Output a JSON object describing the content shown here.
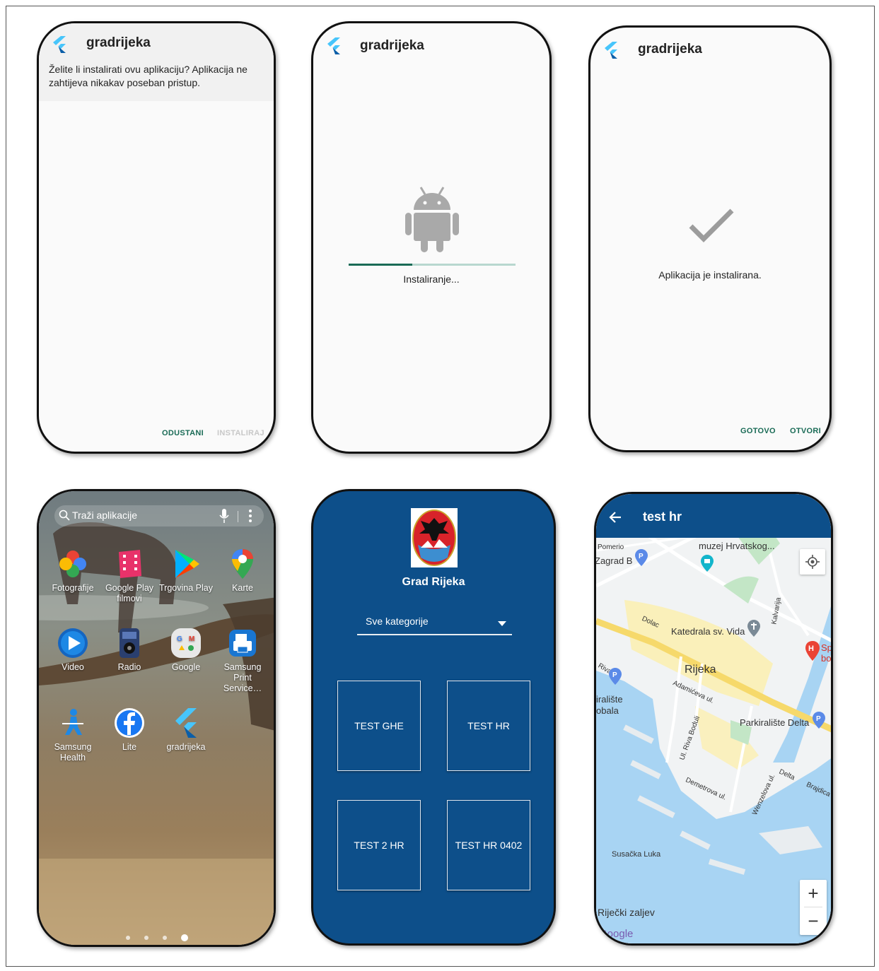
{
  "screen1": {
    "title": "gradrijeka",
    "prompt": "Želite li instalirati ovu aplikaciju? Aplikacija ne zahtijeva nikakav poseban pristup.",
    "cancel_label": "ODUSTANI",
    "install_label": "INSTALIRAJ"
  },
  "screen2": {
    "title": "gradrijeka",
    "status": "Instaliranje...",
    "progress": 0.38
  },
  "screen3": {
    "title": "gradrijeka",
    "status": "Aplikacija je instalirana.",
    "done_label": "GOTOVO",
    "open_label": "OTVORI"
  },
  "screen4": {
    "search_placeholder": "Traži aplikacije",
    "apps": [
      {
        "label": "Fotografije",
        "icon": "google-photos-icon"
      },
      {
        "label": "Google Play filmovi",
        "icon": "play-movies-icon"
      },
      {
        "label": "Trgovina Play",
        "icon": "play-store-icon"
      },
      {
        "label": "Karte",
        "icon": "maps-icon"
      },
      {
        "label": "Video",
        "icon": "video-icon"
      },
      {
        "label": "Radio",
        "icon": "radio-icon"
      },
      {
        "label": "Google",
        "icon": "google-folder-icon"
      },
      {
        "label": "Samsung Print Service…",
        "icon": "print-service-icon"
      },
      {
        "label": "Samsung Health",
        "icon": "samsung-health-icon"
      },
      {
        "label": "Lite",
        "icon": "facebook-lite-icon"
      },
      {
        "label": "gradrijeka",
        "icon": "flutter-icon"
      }
    ],
    "page_dots": 4,
    "active_page": 4
  },
  "screen5": {
    "title": "Grad Rijeka",
    "dropdown_value": "Sve kategorije",
    "tiles": [
      "TEST GHE",
      "TEST HR",
      "TEST 2 HR",
      "TEST HR 0402"
    ],
    "bg_color": "#0d4f8a"
  },
  "screen6": {
    "title": "test hr",
    "labels": {
      "muzej": "muzej Hrvatskog...",
      "pomerio": "Pomerio",
      "zagrad": "Zagrad B",
      "katedrala": "Katedrala sv. Vida",
      "rijeka": "Rijeka",
      "parkiraliste_obala": "iralište\nobala",
      "parkiraliste_delta": "Parkiralište Delta",
      "adamiceva": "Adamićeva ul.",
      "riva_boduli": "Ul. Riva Boduli",
      "demetrova": "Demetrova ul.",
      "wenzelova": "Wenzelova ul.",
      "delta": "Delta",
      "brajdica": "Brajdica",
      "susacka_luka": "Susačka Luka",
      "rijecki_zaljev": "Riječki zaljev",
      "dolac": "Dolac",
      "kalvarija": "Kalvarija",
      "riva": "Riva",
      "hospital": "Sp\nbol",
      "google": "Google"
    },
    "zoom_in": "+",
    "zoom_out": "−",
    "accent_color": "#0d4f8a"
  }
}
